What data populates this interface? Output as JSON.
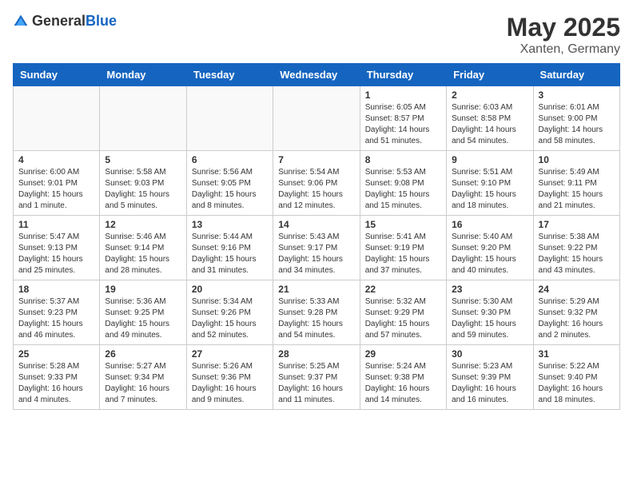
{
  "header": {
    "logo_general": "General",
    "logo_blue": "Blue",
    "month": "May 2025",
    "location": "Xanten, Germany"
  },
  "days_of_week": [
    "Sunday",
    "Monday",
    "Tuesday",
    "Wednesday",
    "Thursday",
    "Friday",
    "Saturday"
  ],
  "weeks": [
    [
      {
        "day": "",
        "info": ""
      },
      {
        "day": "",
        "info": ""
      },
      {
        "day": "",
        "info": ""
      },
      {
        "day": "",
        "info": ""
      },
      {
        "day": "1",
        "info": "Sunrise: 6:05 AM\nSunset: 8:57 PM\nDaylight: 14 hours\nand 51 minutes."
      },
      {
        "day": "2",
        "info": "Sunrise: 6:03 AM\nSunset: 8:58 PM\nDaylight: 14 hours\nand 54 minutes."
      },
      {
        "day": "3",
        "info": "Sunrise: 6:01 AM\nSunset: 9:00 PM\nDaylight: 14 hours\nand 58 minutes."
      }
    ],
    [
      {
        "day": "4",
        "info": "Sunrise: 6:00 AM\nSunset: 9:01 PM\nDaylight: 15 hours\nand 1 minute."
      },
      {
        "day": "5",
        "info": "Sunrise: 5:58 AM\nSunset: 9:03 PM\nDaylight: 15 hours\nand 5 minutes."
      },
      {
        "day": "6",
        "info": "Sunrise: 5:56 AM\nSunset: 9:05 PM\nDaylight: 15 hours\nand 8 minutes."
      },
      {
        "day": "7",
        "info": "Sunrise: 5:54 AM\nSunset: 9:06 PM\nDaylight: 15 hours\nand 12 minutes."
      },
      {
        "day": "8",
        "info": "Sunrise: 5:53 AM\nSunset: 9:08 PM\nDaylight: 15 hours\nand 15 minutes."
      },
      {
        "day": "9",
        "info": "Sunrise: 5:51 AM\nSunset: 9:10 PM\nDaylight: 15 hours\nand 18 minutes."
      },
      {
        "day": "10",
        "info": "Sunrise: 5:49 AM\nSunset: 9:11 PM\nDaylight: 15 hours\nand 21 minutes."
      }
    ],
    [
      {
        "day": "11",
        "info": "Sunrise: 5:47 AM\nSunset: 9:13 PM\nDaylight: 15 hours\nand 25 minutes."
      },
      {
        "day": "12",
        "info": "Sunrise: 5:46 AM\nSunset: 9:14 PM\nDaylight: 15 hours\nand 28 minutes."
      },
      {
        "day": "13",
        "info": "Sunrise: 5:44 AM\nSunset: 9:16 PM\nDaylight: 15 hours\nand 31 minutes."
      },
      {
        "day": "14",
        "info": "Sunrise: 5:43 AM\nSunset: 9:17 PM\nDaylight: 15 hours\nand 34 minutes."
      },
      {
        "day": "15",
        "info": "Sunrise: 5:41 AM\nSunset: 9:19 PM\nDaylight: 15 hours\nand 37 minutes."
      },
      {
        "day": "16",
        "info": "Sunrise: 5:40 AM\nSunset: 9:20 PM\nDaylight: 15 hours\nand 40 minutes."
      },
      {
        "day": "17",
        "info": "Sunrise: 5:38 AM\nSunset: 9:22 PM\nDaylight: 15 hours\nand 43 minutes."
      }
    ],
    [
      {
        "day": "18",
        "info": "Sunrise: 5:37 AM\nSunset: 9:23 PM\nDaylight: 15 hours\nand 46 minutes."
      },
      {
        "day": "19",
        "info": "Sunrise: 5:36 AM\nSunset: 9:25 PM\nDaylight: 15 hours\nand 49 minutes."
      },
      {
        "day": "20",
        "info": "Sunrise: 5:34 AM\nSunset: 9:26 PM\nDaylight: 15 hours\nand 52 minutes."
      },
      {
        "day": "21",
        "info": "Sunrise: 5:33 AM\nSunset: 9:28 PM\nDaylight: 15 hours\nand 54 minutes."
      },
      {
        "day": "22",
        "info": "Sunrise: 5:32 AM\nSunset: 9:29 PM\nDaylight: 15 hours\nand 57 minutes."
      },
      {
        "day": "23",
        "info": "Sunrise: 5:30 AM\nSunset: 9:30 PM\nDaylight: 15 hours\nand 59 minutes."
      },
      {
        "day": "24",
        "info": "Sunrise: 5:29 AM\nSunset: 9:32 PM\nDaylight: 16 hours\nand 2 minutes."
      }
    ],
    [
      {
        "day": "25",
        "info": "Sunrise: 5:28 AM\nSunset: 9:33 PM\nDaylight: 16 hours\nand 4 minutes."
      },
      {
        "day": "26",
        "info": "Sunrise: 5:27 AM\nSunset: 9:34 PM\nDaylight: 16 hours\nand 7 minutes."
      },
      {
        "day": "27",
        "info": "Sunrise: 5:26 AM\nSunset: 9:36 PM\nDaylight: 16 hours\nand 9 minutes."
      },
      {
        "day": "28",
        "info": "Sunrise: 5:25 AM\nSunset: 9:37 PM\nDaylight: 16 hours\nand 11 minutes."
      },
      {
        "day": "29",
        "info": "Sunrise: 5:24 AM\nSunset: 9:38 PM\nDaylight: 16 hours\nand 14 minutes."
      },
      {
        "day": "30",
        "info": "Sunrise: 5:23 AM\nSunset: 9:39 PM\nDaylight: 16 hours\nand 16 minutes."
      },
      {
        "day": "31",
        "info": "Sunrise: 5:22 AM\nSunset: 9:40 PM\nDaylight: 16 hours\nand 18 minutes."
      }
    ]
  ]
}
